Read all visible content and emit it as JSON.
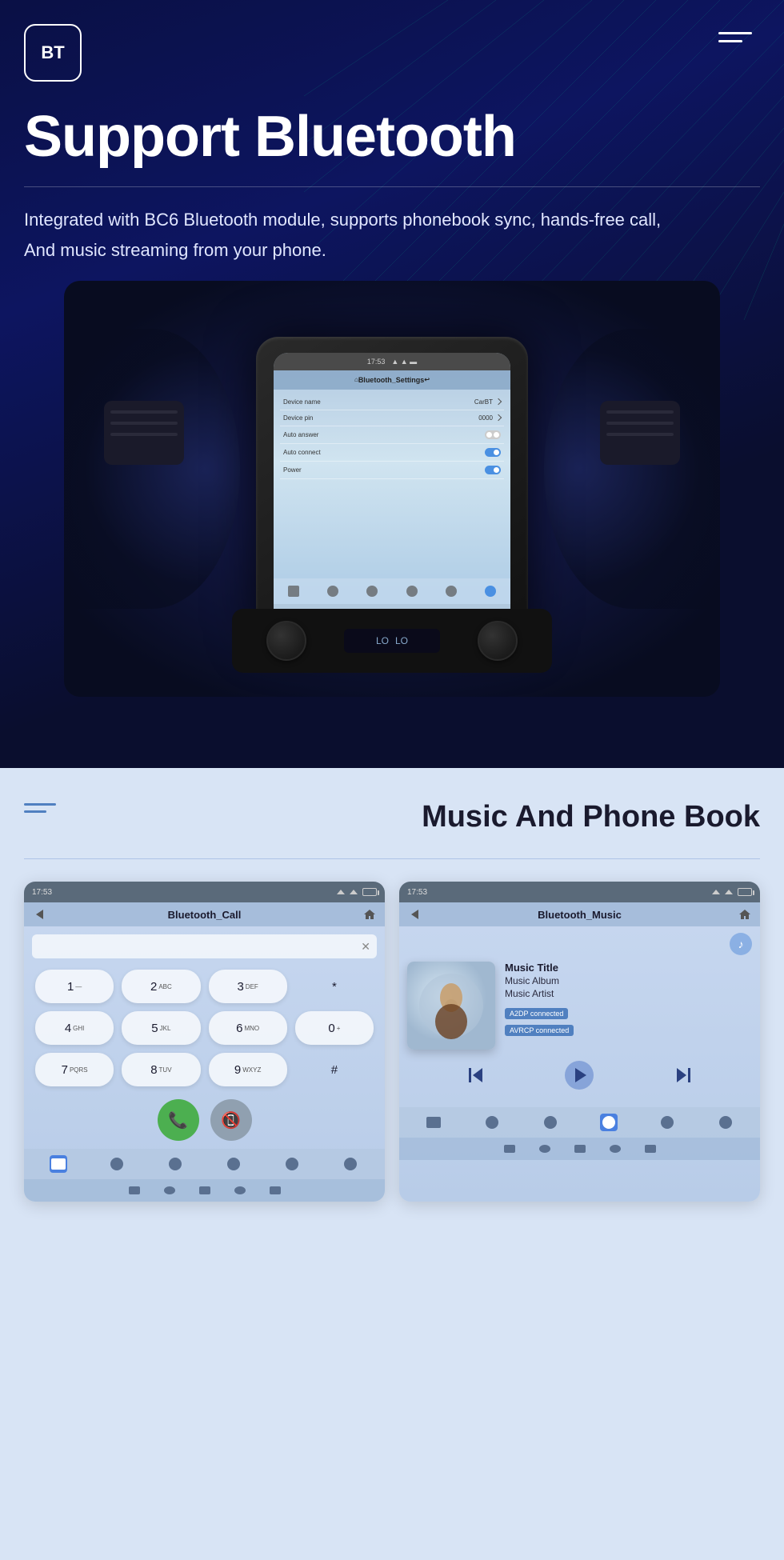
{
  "header": {
    "logo_text": "BT",
    "menu_icon": "hamburger-icon"
  },
  "hero": {
    "title": "Support Bluetooth",
    "divider": true,
    "description_line1": "Integrated with BC6 Bluetooth module, supports phonebook sync, hands-free call,",
    "description_line2": "And music streaming from your phone."
  },
  "headunit": {
    "statusbar_time": "17:53",
    "screen_title": "Bluetooth_Settings",
    "rows": [
      {
        "label": "Device name",
        "value": "CarBT",
        "has_chevron": true
      },
      {
        "label": "Device pin",
        "value": "0000",
        "has_chevron": true
      },
      {
        "label": "Auto answer",
        "value": "",
        "has_toggle": true,
        "toggle_on": false
      },
      {
        "label": "Auto connect",
        "value": "",
        "has_toggle": true,
        "toggle_on": true
      },
      {
        "label": "Power",
        "value": "",
        "has_toggle": true,
        "toggle_on": true
      }
    ]
  },
  "bottom_section": {
    "title": "Music And Phone Book",
    "call_screen": {
      "statusbar_time": "17:53",
      "screen_title": "Bluetooth_Call",
      "dialpad": [
        [
          "1",
          "2 ABC",
          "3 DEF",
          "*"
        ],
        [
          "4 GHI",
          "5 JKL",
          "6 MNO",
          "0+"
        ],
        [
          "7 PQRS",
          "8 TUV",
          "9 WXYZ",
          "#"
        ]
      ],
      "call_button_label": "Call",
      "hangup_button_label": "Hangup"
    },
    "music_screen": {
      "statusbar_time": "17:53",
      "screen_title": "Bluetooth_Music",
      "music_title": "Music Title",
      "music_album": "Music Album",
      "music_artist": "Music Artist",
      "badge_a2dp": "A2DP connected",
      "badge_avrcp": "AVRCP connected",
      "controls": {
        "prev": "prev",
        "play": "play",
        "next": "next"
      }
    }
  }
}
